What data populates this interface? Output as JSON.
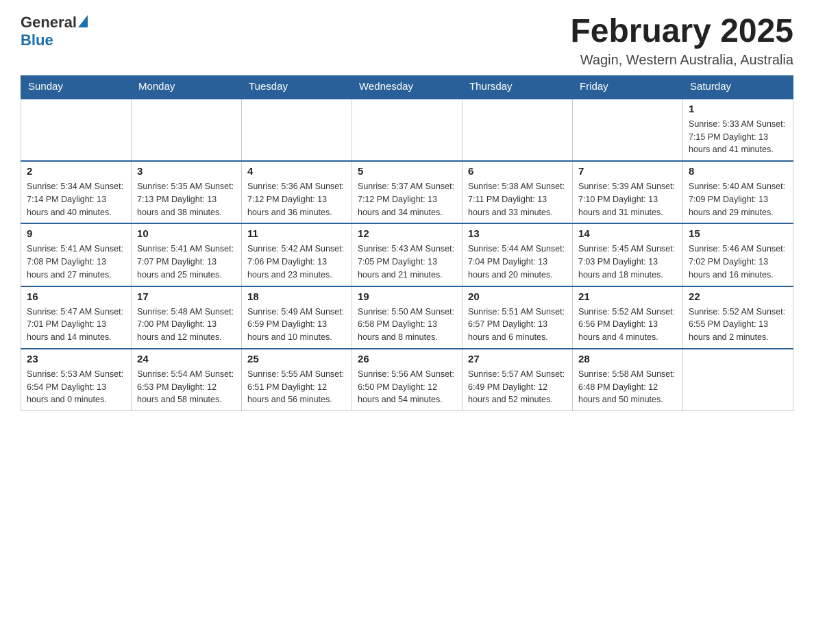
{
  "header": {
    "logo_general": "General",
    "logo_blue": "Blue",
    "month_title": "February 2025",
    "location": "Wagin, Western Australia, Australia"
  },
  "days_of_week": [
    "Sunday",
    "Monday",
    "Tuesday",
    "Wednesday",
    "Thursday",
    "Friday",
    "Saturday"
  ],
  "weeks": [
    [
      {
        "day": "",
        "info": ""
      },
      {
        "day": "",
        "info": ""
      },
      {
        "day": "",
        "info": ""
      },
      {
        "day": "",
        "info": ""
      },
      {
        "day": "",
        "info": ""
      },
      {
        "day": "",
        "info": ""
      },
      {
        "day": "1",
        "info": "Sunrise: 5:33 AM\nSunset: 7:15 PM\nDaylight: 13 hours and 41 minutes."
      }
    ],
    [
      {
        "day": "2",
        "info": "Sunrise: 5:34 AM\nSunset: 7:14 PM\nDaylight: 13 hours and 40 minutes."
      },
      {
        "day": "3",
        "info": "Sunrise: 5:35 AM\nSunset: 7:13 PM\nDaylight: 13 hours and 38 minutes."
      },
      {
        "day": "4",
        "info": "Sunrise: 5:36 AM\nSunset: 7:12 PM\nDaylight: 13 hours and 36 minutes."
      },
      {
        "day": "5",
        "info": "Sunrise: 5:37 AM\nSunset: 7:12 PM\nDaylight: 13 hours and 34 minutes."
      },
      {
        "day": "6",
        "info": "Sunrise: 5:38 AM\nSunset: 7:11 PM\nDaylight: 13 hours and 33 minutes."
      },
      {
        "day": "7",
        "info": "Sunrise: 5:39 AM\nSunset: 7:10 PM\nDaylight: 13 hours and 31 minutes."
      },
      {
        "day": "8",
        "info": "Sunrise: 5:40 AM\nSunset: 7:09 PM\nDaylight: 13 hours and 29 minutes."
      }
    ],
    [
      {
        "day": "9",
        "info": "Sunrise: 5:41 AM\nSunset: 7:08 PM\nDaylight: 13 hours and 27 minutes."
      },
      {
        "day": "10",
        "info": "Sunrise: 5:41 AM\nSunset: 7:07 PM\nDaylight: 13 hours and 25 minutes."
      },
      {
        "day": "11",
        "info": "Sunrise: 5:42 AM\nSunset: 7:06 PM\nDaylight: 13 hours and 23 minutes."
      },
      {
        "day": "12",
        "info": "Sunrise: 5:43 AM\nSunset: 7:05 PM\nDaylight: 13 hours and 21 minutes."
      },
      {
        "day": "13",
        "info": "Sunrise: 5:44 AM\nSunset: 7:04 PM\nDaylight: 13 hours and 20 minutes."
      },
      {
        "day": "14",
        "info": "Sunrise: 5:45 AM\nSunset: 7:03 PM\nDaylight: 13 hours and 18 minutes."
      },
      {
        "day": "15",
        "info": "Sunrise: 5:46 AM\nSunset: 7:02 PM\nDaylight: 13 hours and 16 minutes."
      }
    ],
    [
      {
        "day": "16",
        "info": "Sunrise: 5:47 AM\nSunset: 7:01 PM\nDaylight: 13 hours and 14 minutes."
      },
      {
        "day": "17",
        "info": "Sunrise: 5:48 AM\nSunset: 7:00 PM\nDaylight: 13 hours and 12 minutes."
      },
      {
        "day": "18",
        "info": "Sunrise: 5:49 AM\nSunset: 6:59 PM\nDaylight: 13 hours and 10 minutes."
      },
      {
        "day": "19",
        "info": "Sunrise: 5:50 AM\nSunset: 6:58 PM\nDaylight: 13 hours and 8 minutes."
      },
      {
        "day": "20",
        "info": "Sunrise: 5:51 AM\nSunset: 6:57 PM\nDaylight: 13 hours and 6 minutes."
      },
      {
        "day": "21",
        "info": "Sunrise: 5:52 AM\nSunset: 6:56 PM\nDaylight: 13 hours and 4 minutes."
      },
      {
        "day": "22",
        "info": "Sunrise: 5:52 AM\nSunset: 6:55 PM\nDaylight: 13 hours and 2 minutes."
      }
    ],
    [
      {
        "day": "23",
        "info": "Sunrise: 5:53 AM\nSunset: 6:54 PM\nDaylight: 13 hours and 0 minutes."
      },
      {
        "day": "24",
        "info": "Sunrise: 5:54 AM\nSunset: 6:53 PM\nDaylight: 12 hours and 58 minutes."
      },
      {
        "day": "25",
        "info": "Sunrise: 5:55 AM\nSunset: 6:51 PM\nDaylight: 12 hours and 56 minutes."
      },
      {
        "day": "26",
        "info": "Sunrise: 5:56 AM\nSunset: 6:50 PM\nDaylight: 12 hours and 54 minutes."
      },
      {
        "day": "27",
        "info": "Sunrise: 5:57 AM\nSunset: 6:49 PM\nDaylight: 12 hours and 52 minutes."
      },
      {
        "day": "28",
        "info": "Sunrise: 5:58 AM\nSunset: 6:48 PM\nDaylight: 12 hours and 50 minutes."
      },
      {
        "day": "",
        "info": ""
      }
    ]
  ]
}
